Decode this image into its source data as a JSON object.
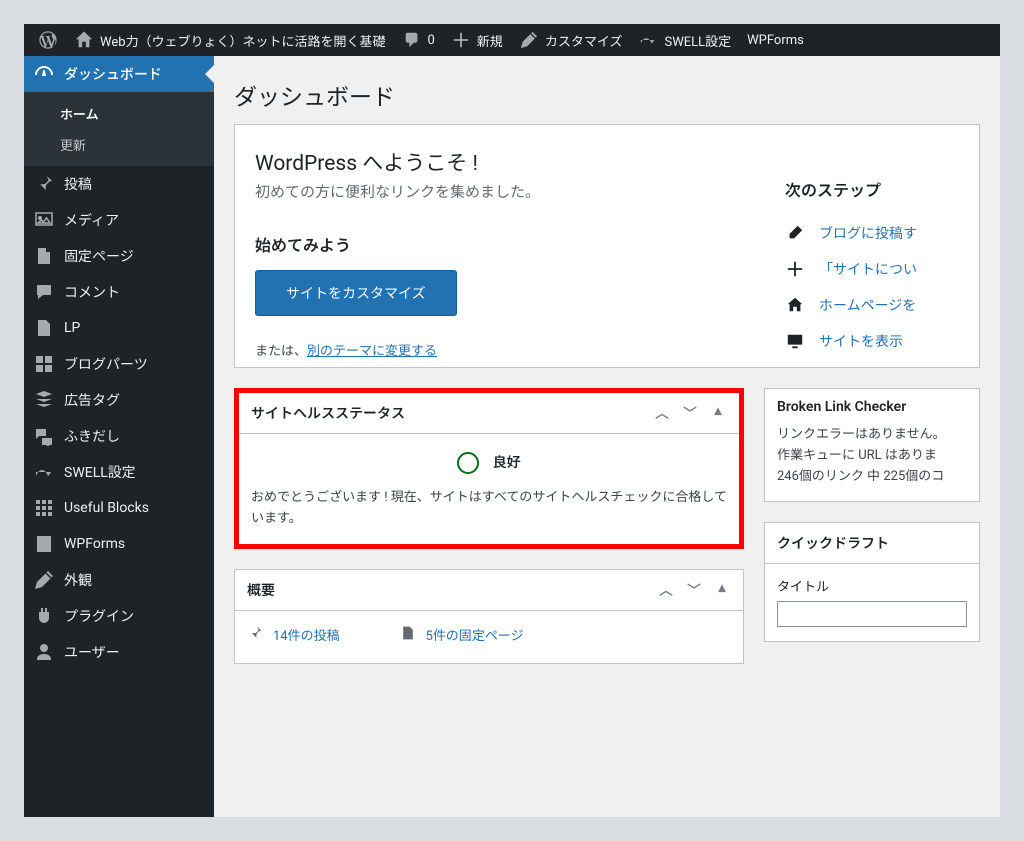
{
  "adminbar": {
    "site_title": "Web力（ウェブりょく）ネットに活路を開く基礎",
    "comments_count": "0",
    "new_label": "新規",
    "customize_label": "カスタマイズ",
    "swell_label": "SWELL設定",
    "wpforms_label": "WPForms"
  },
  "menu": {
    "dashboard": "ダッシュボード",
    "submenu": {
      "home": "ホーム",
      "updates": "更新"
    },
    "posts": "投稿",
    "media": "メディア",
    "pages": "固定ページ",
    "comments": "コメント",
    "lp": "LP",
    "blog_parts": "ブログパーツ",
    "ad_tags": "広告タグ",
    "balloon": "ふきだし",
    "swell_settings": "SWELL設定",
    "useful_blocks": "Useful Blocks",
    "wpforms": "WPForms",
    "appearance": "外観",
    "plugins": "プラグイン",
    "users": "ユーザー"
  },
  "page": {
    "title": "ダッシュボード"
  },
  "welcome": {
    "heading": "WordPress へようこそ !",
    "about": "初めての方に便利なリンクを集めました。",
    "get_started": "始めてみよう",
    "customize_button": "サイトをカスタマイズ",
    "or_prefix": "または、",
    "change_theme_link": "別のテーマに変更する",
    "next_steps_heading": "次のステップ",
    "ns_blog": "ブログに投稿す",
    "ns_about": "「サイトについ",
    "ns_home": "ホームページを",
    "ns_view": "サイトを表示"
  },
  "site_health": {
    "box_title": "サイトヘルスステータス",
    "status_label": "良好",
    "message": "おめでとうございます ! 現在、サイトはすべてのサイトヘルスチェックに合格しています。"
  },
  "overview": {
    "box_title": "概要",
    "posts": "14件の投稿",
    "pages": "5件の固定ページ"
  },
  "blc": {
    "box_title": "Broken Link Checker",
    "line1": "リンクエラーはありません。",
    "line2": "作業キューに URL はありま",
    "line3": "246個のリンク 中 225個のコ"
  },
  "quick_draft": {
    "box_title": "クイックドラフト",
    "title_label": "タイトル"
  }
}
